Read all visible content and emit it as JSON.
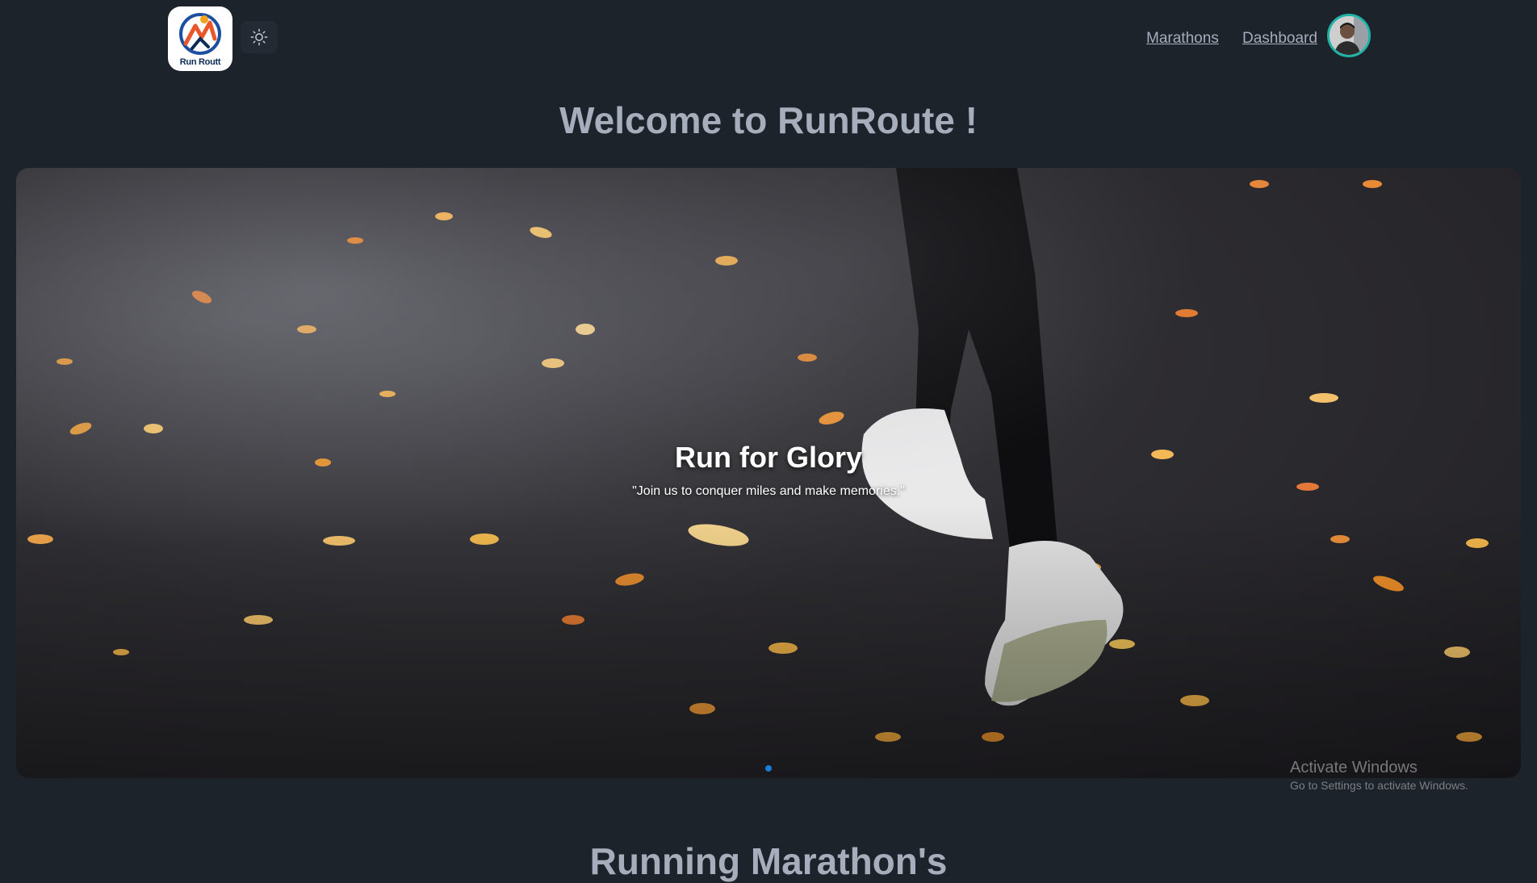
{
  "header": {
    "logo_text": "Run Routt",
    "nav": [
      {
        "label": "Marathons"
      },
      {
        "label": "Dashboard"
      }
    ]
  },
  "welcome": "Welcome to RunRoute !",
  "hero": {
    "title": "Run for Glory",
    "subtitle": "\"Join us to conquer miles and make memories.\"",
    "slide_count": 1,
    "active_slide": 1
  },
  "watermark": {
    "line1": "Activate Windows",
    "line2": "Go to Settings to activate Windows."
  },
  "section_title": "Running Marathon's",
  "colors": {
    "background": "#1d232a",
    "text": "#a6adbb",
    "avatar_ring": "#1fb2a6",
    "carousel_dot": "#1d7bd8"
  },
  "icons": {
    "theme_toggle": "sun-icon"
  }
}
